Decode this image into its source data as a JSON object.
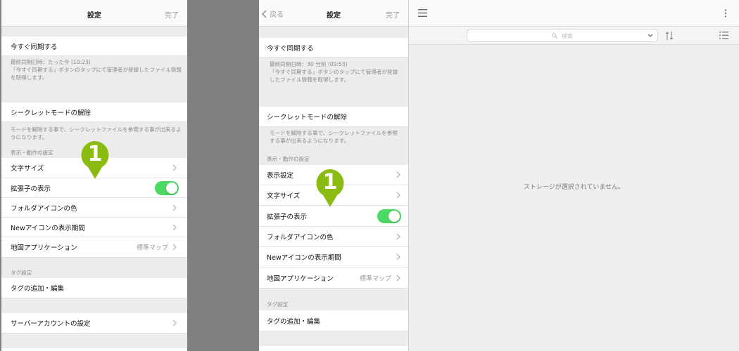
{
  "left_panel": {
    "nav_title": "設定",
    "nav_done": "完了",
    "sync_now": "今すぐ同期する",
    "sync_note": "最終同期日時：たった今 (10:23)\n「今すぐ同期する」ボタンのタップにて管理者が登録したファイル情報を取得します。",
    "secret_mode": "シークレットモードの解除",
    "secret_note": "モードを解除する事で、シークレットファイルを参照する事が出来るようになります。",
    "section_display": "表示・動作の設定",
    "font_size": "文字サイズ",
    "show_extension": "拡張子の表示",
    "folder_icon_color": "フォルダアイコンの色",
    "new_icon_period": "Newアイコンの表示期間",
    "map_app": "地図アプリケーション",
    "map_app_value": "標準マップ",
    "section_tag": "タグ設定",
    "tag_edit": "タグの追加・編集",
    "server_account": "サーバーアカウントの設定",
    "callout_number": "1",
    "show_extension_on": true
  },
  "mid_panel": {
    "nav_back": "戻る",
    "nav_title": "設定",
    "nav_done": "完了",
    "sync_now": "今すぐ同期する",
    "sync_note": "最終同期日時：30 分前 (09:53)\n「今すぐ同期する」ボタンのタップにて管理者が登録したファイル情報を取得します。",
    "secret_mode": "シークレットモードの解除",
    "secret_note": "モードを解除する事で、シークレットファイルを参照する事が出来るようになります。",
    "section_display": "表示・動作の設定",
    "display_settings": "表示設定",
    "font_size": "文字サイズ",
    "show_extension": "拡張子の表示",
    "folder_icon_color": "フォルダアイコンの色",
    "new_icon_period": "Newアイコンの表示期間",
    "map_app": "地図アプリケーション",
    "map_app_value": "標準マップ",
    "section_tag": "タグ設定",
    "tag_edit": "タグの追加・編集",
    "callout_number": "1",
    "show_extension_on": true
  },
  "right_panel": {
    "search_placeholder": "検索",
    "empty_message": "ストレージが選択されていません。"
  },
  "colors": {
    "callout": "#8bbb10",
    "toggle_on": "#4cd964",
    "panel_bg": "#ececec",
    "gutter": "#7f7f7f"
  },
  "icons": [
    "chevron-right-icon",
    "back-chevron-icon",
    "menu-icon",
    "more-vertical-icon",
    "search-icon",
    "dropdown-chevron-icon",
    "sort-icon",
    "list-icon"
  ]
}
